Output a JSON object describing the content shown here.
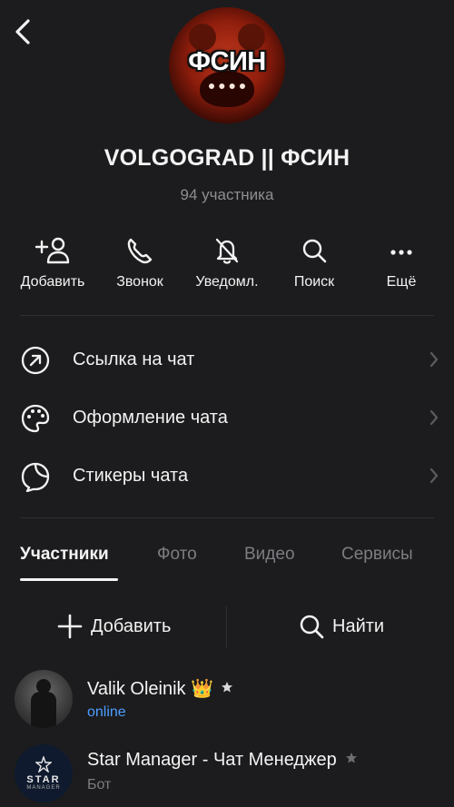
{
  "header": {
    "avatar_text": "ФСИН",
    "title": "VOLGOGRAD || ФСИН",
    "subtitle": "94 участника"
  },
  "actions": [
    {
      "label": "Добавить",
      "icon": "add-person-icon"
    },
    {
      "label": "Звонок",
      "icon": "phone-icon"
    },
    {
      "label": "Уведомл.",
      "icon": "bell-muted-icon"
    },
    {
      "label": "Поиск",
      "icon": "search-icon"
    },
    {
      "label": "Ещё",
      "icon": "more-dots-icon"
    }
  ],
  "settings": [
    {
      "label": "Ссылка на чат",
      "icon": "link-arrow-icon"
    },
    {
      "label": "Оформление чата",
      "icon": "palette-icon"
    },
    {
      "label": "Стикеры чата",
      "icon": "sticker-icon"
    }
  ],
  "tabs": [
    {
      "label": "Участники",
      "active": true
    },
    {
      "label": "Фото",
      "active": false
    },
    {
      "label": "Видео",
      "active": false
    },
    {
      "label": "Сервисы",
      "active": false
    }
  ],
  "member_actions": {
    "add_label": "Добавить",
    "find_label": "Найти"
  },
  "members": [
    {
      "name": "Valik Oleinik",
      "emoji": "👑",
      "status": "online",
      "status_type": "online"
    },
    {
      "name": "Star Manager - Чат Менеджер",
      "status": "Бот",
      "status_type": "bot",
      "avatar_text": "STAR",
      "avatar_subtext": "MANAGER"
    }
  ],
  "colors": {
    "background": "#1c1c1e",
    "accent_online": "#4a9dff",
    "muted": "#8e8e93"
  }
}
